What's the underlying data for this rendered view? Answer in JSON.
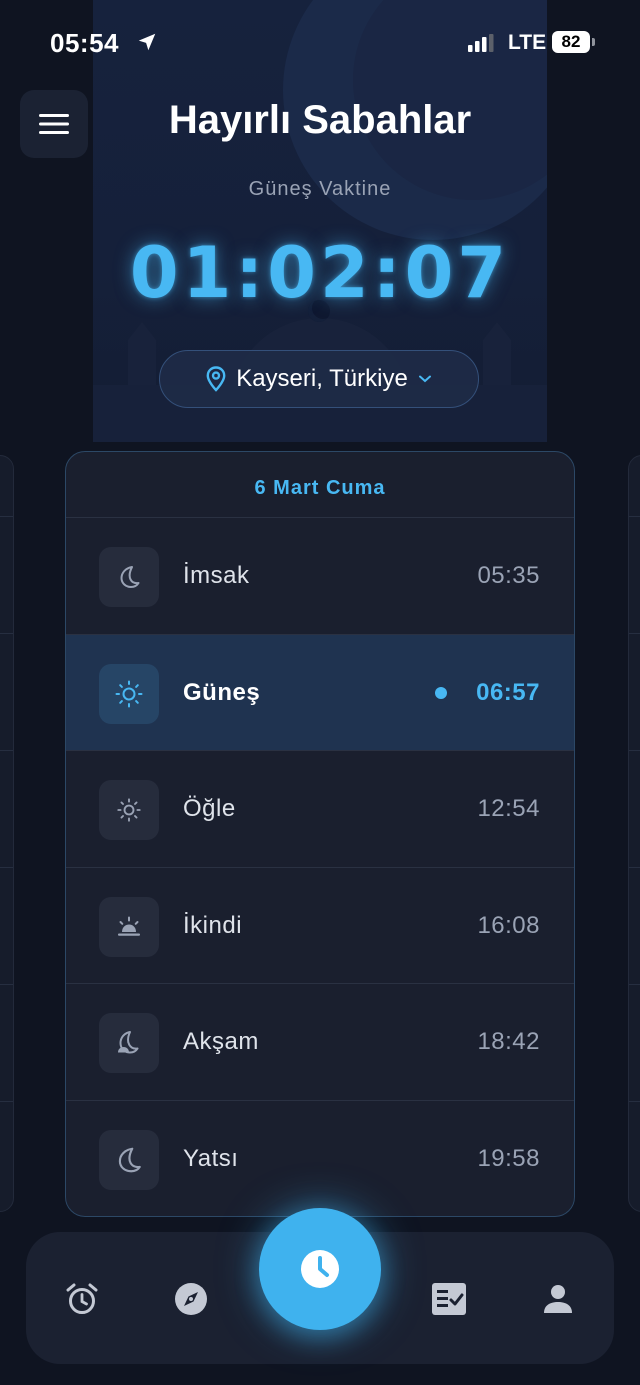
{
  "status_bar": {
    "time": "05:54",
    "network": "LTE",
    "battery": "82"
  },
  "header": {
    "greeting": "Hayırlı Sabahlar",
    "subtitle": "Güneş Vaktine",
    "countdown": "01:02:07",
    "location": "Kayseri, Türkiye"
  },
  "card": {
    "date": "6 Mart Cuma",
    "prayers": [
      {
        "name": "İmsak",
        "time": "05:35",
        "icon": "moon-icon"
      },
      {
        "name": "Güneş",
        "time": "06:57",
        "icon": "sun-icon",
        "active": true
      },
      {
        "name": "Öğle",
        "time": "12:54",
        "icon": "sun-icon"
      },
      {
        "name": "İkindi",
        "time": "16:08",
        "icon": "sunset-icon"
      },
      {
        "name": "Akşam",
        "time": "18:42",
        "icon": "moon-set-icon"
      },
      {
        "name": "Yatsı",
        "time": "19:58",
        "icon": "moon-icon"
      }
    ]
  },
  "bottom_nav": {
    "items": [
      "alarm-icon",
      "compass-icon",
      "clock-icon",
      "checklist-icon",
      "profile-icon"
    ],
    "active": "clock-icon"
  },
  "colors": {
    "accent": "#48b8f3",
    "background": "#0f1421",
    "card": "#1a1f2e",
    "active_row": "#1f3350"
  }
}
